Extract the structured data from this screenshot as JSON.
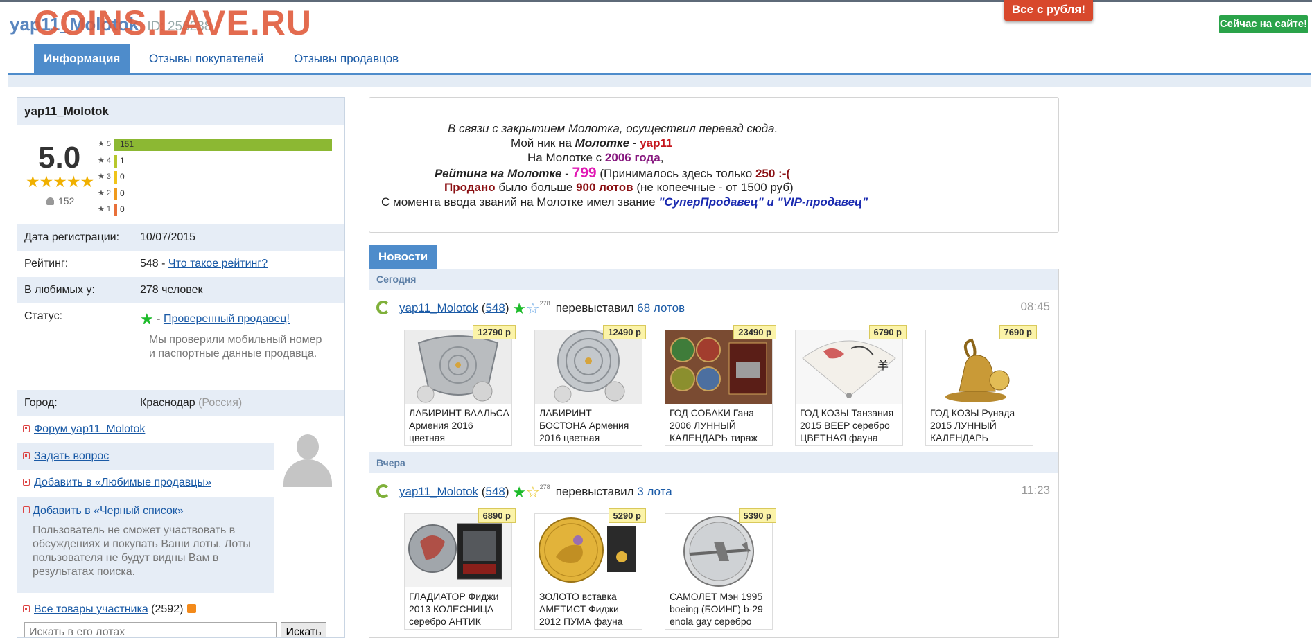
{
  "header": {
    "watermark": "COINS.LAVE.RU",
    "username": "yap11_Molotok",
    "user_id": "ID: 256238",
    "promo_button": "Все с рубля!",
    "online_button": "Сейчас на сайте!"
  },
  "tabs": [
    {
      "label": "Информация"
    },
    {
      "label": "Отзывы покупателей"
    },
    {
      "label": "Отзывы продавцов"
    }
  ],
  "profile": {
    "name": "yap11_Molotok",
    "score": "5.0",
    "stars": "★★★★★",
    "votes": "152",
    "rating_breakdown": [
      {
        "stars": 5,
        "count": 151,
        "color": "#8cb833"
      },
      {
        "stars": 4,
        "count": 1,
        "color": "#b7c72c"
      },
      {
        "stars": 3,
        "count": 0,
        "color": "#f0c419"
      },
      {
        "stars": 2,
        "count": 0,
        "color": "#f09a1c"
      },
      {
        "stars": 1,
        "count": 0,
        "color": "#e8703a"
      }
    ],
    "reg_label": "Дата регистрации:",
    "reg_value": "10/07/2015",
    "rating_label": "Рейтинг:",
    "rating_value": "548 - ",
    "rating_link": "Что такое рейтинг?",
    "fav_label": "В любимых у:",
    "fav_value": "278 человек",
    "status_label": "Статус:",
    "status_link": "Проверенный продавец!",
    "status_note": "Мы проверили мобильный номер и паспортные данные продавца.",
    "city_label": "Город:",
    "city_value": "Краснодар",
    "country": "(Россия)"
  },
  "actions": {
    "forum": "Форум yap11_Molotok",
    "ask": "Задать вопрос",
    "favorites": "Добавить в «Любимые продавцы»",
    "blacklist": "Добавить в «Черный список»",
    "blacklist_note": "Пользователь не сможет участвовать в обсуждениях и покупать Ваши лоты. Лоты пользователя не будут видны Вам в результатах поиска.",
    "all_items": "Все товары участника",
    "all_items_count": "(2592)",
    "search_placeholder": "Искать в его лотах",
    "search_button": "Искать"
  },
  "announcement": {
    "l1": "В связи с закрытием Молотка, осуществил переезд сюда.",
    "l2a": "Мой ник на ",
    "l2b": "Молотке",
    "l2c": " - ",
    "l2d": "yap11",
    "l3a": "На Молотке с ",
    "l3b": "2006 года",
    "l3c": ",",
    "l4a": "Рейтинг на Молотке",
    "l4b": " - ",
    "l4c": "799",
    "l4d": " (Принималось здесь только ",
    "l4e": "250 :-(",
    "l5a": "Продано",
    "l5b": " было больше ",
    "l5c": "900 лотов",
    "l5d": " (не копеечные - от 1500 руб)",
    "l6a": "С момента ввода званий на Молотке имел звание ",
    "l6b": "\"СуперПродавец\" и \"VIP-продавец\""
  },
  "news": {
    "tab": "Новости",
    "days": [
      {
        "label": "Сегодня",
        "user": "yap11_Molotok",
        "rating": "548",
        "sup": "278",
        "action": "перевыставил",
        "lots_link": "68 лотов",
        "time": "08:45",
        "lots": [
          {
            "price": "12790 р",
            "title": "ЛАБИРИНТ ВААЛЬСА Армения 2016 цветная"
          },
          {
            "price": "12490 р",
            "title": "ЛАБИРИНТ БОСТОНА Армения 2016 цветная"
          },
          {
            "price": "23490 р",
            "title": "ГОД СОБАКИ Гана 2006 ЛУННЫЙ КАЛЕНДАРЬ тираж"
          },
          {
            "price": "6790 р",
            "title": "ГОД КОЗЫ Танзания 2015 BEEP серебро ЦВЕТНАЯ фауна"
          },
          {
            "price": "7690 р",
            "title": "ГОД КОЗЫ Рунада 2015 ЛУННЫЙ КАЛЕНДАРЬ"
          }
        ]
      },
      {
        "label": "Вчера",
        "user": "yap11_Molotok",
        "rating": "548",
        "sup": "278",
        "action": "перевыставил",
        "lots_link": "3 лота",
        "time": "11:23",
        "lots": [
          {
            "price": "6890 р",
            "title": "ГЛАДИАТОР Фиджи 2013 КОЛЕСНИЦА серебро АНТИК"
          },
          {
            "price": "5290 р",
            "title": "ЗОЛОТО вставка АМЕТИСТ Фиджи 2012 ПУМА фауна"
          },
          {
            "price": "5390 р",
            "title": "САМОЛЕТ Мэн 1995 boeing (БОИНГ) b-29 enola gay серебро"
          }
        ]
      }
    ]
  }
}
